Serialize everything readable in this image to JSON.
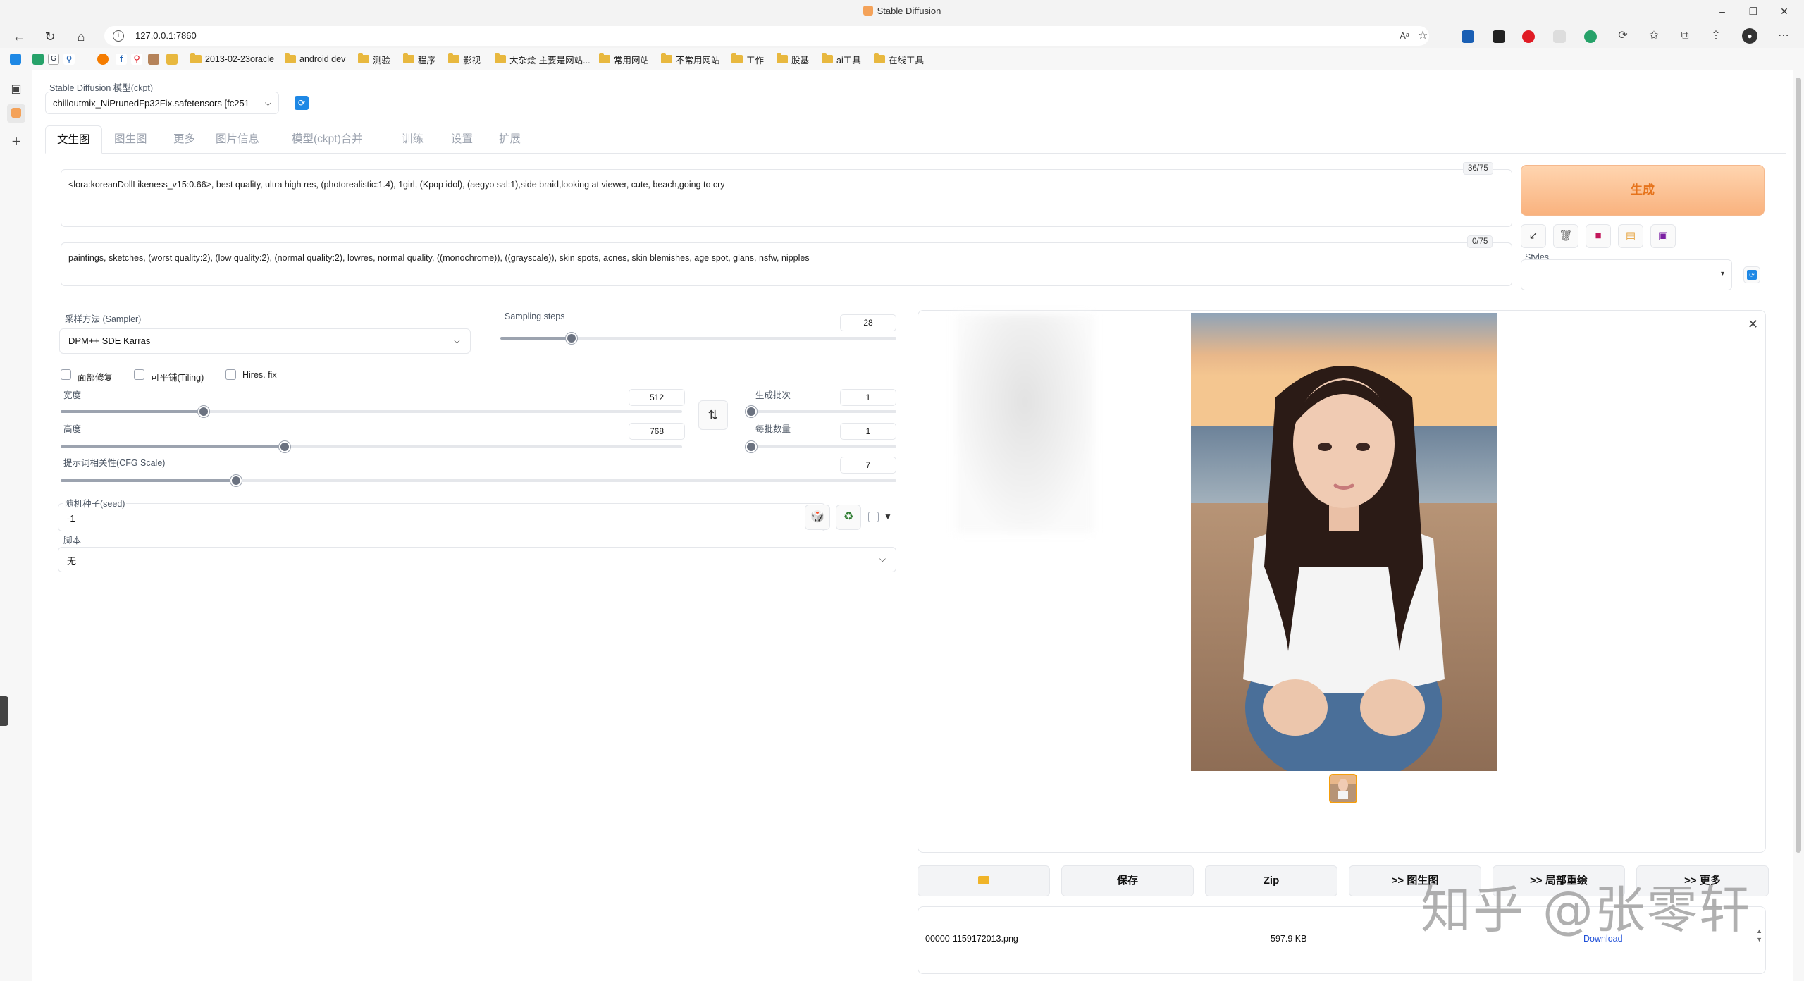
{
  "browser": {
    "window_title": "Stable Diffusion",
    "url": "127.0.0.1:7860",
    "bookmarks": [
      "2013-02-23oracle",
      "android dev",
      "测验",
      "程序",
      "影视",
      "大杂烩-主要是网站...",
      "常用网站",
      "不常用网站",
      "工作",
      "股基",
      "ai工具",
      "在线工具"
    ]
  },
  "app": {
    "model_label": "Stable Diffusion 模型(ckpt)",
    "model_value": "chilloutmix_NiPrunedFp32Fix.safetensors [fc251",
    "tabs": [
      "文生图",
      "图生图",
      "更多",
      "图片信息",
      "模型(ckpt)合并",
      "训练",
      "设置",
      "扩展"
    ],
    "prompt": "<lora:koreanDollLikeness_v15:0.66>, best quality, ultra high res, (photorealistic:1.4), 1girl, (Kpop idol), (aegyo sal:1),side braid,looking at viewer,  cute, beach,going to cry",
    "prompt_counter": "36/75",
    "negative_prompt": "paintings, sketches, (worst quality:2), (low quality:2), (normal quality:2), lowres, normal quality, ((monochrome)), ((grayscale)), skin spots, acnes, skin blemishes, age spot, glans, nsfw, nipples",
    "negative_counter": "0/75",
    "generate_label": "生成",
    "styles_label": "Styles",
    "sampler_label": "采样方法 (Sampler)",
    "sampler_value": "DPM++ SDE Karras",
    "steps_label": "Sampling steps",
    "steps_value": "28",
    "steps_fraction": 0.18,
    "checkboxes": [
      "面部修复",
      "可平铺(Tiling)",
      "Hires. fix"
    ],
    "width_label": "宽度",
    "width_value": "512",
    "width_fraction": 0.23,
    "height_label": "高度",
    "height_value": "768",
    "height_fraction": 0.36,
    "batch_count_label": "生成批次",
    "batch_count_value": "1",
    "batch_size_label": "每批数量",
    "batch_size_value": "1",
    "cfg_label": "提示词相关性(CFG Scale)",
    "cfg_value": "7",
    "cfg_fraction": 0.21,
    "seed_label": "随机种子(seed)",
    "seed_value": "-1",
    "script_label": "脚本",
    "script_value": "无",
    "output_buttons": [
      "",
      "保存",
      "Zip",
      ">> 图生图",
      ">> 局部重绘",
      ">> 更多"
    ],
    "file_name": "00000-1159172013.png",
    "file_size": "597.9 KB",
    "download_label": "Download"
  },
  "watermark": "知乎 @张零轩",
  "colors": {
    "generate_bg": "#f9b27e",
    "generate_text": "#e6731b",
    "accent_blue": "#1e88e5"
  }
}
